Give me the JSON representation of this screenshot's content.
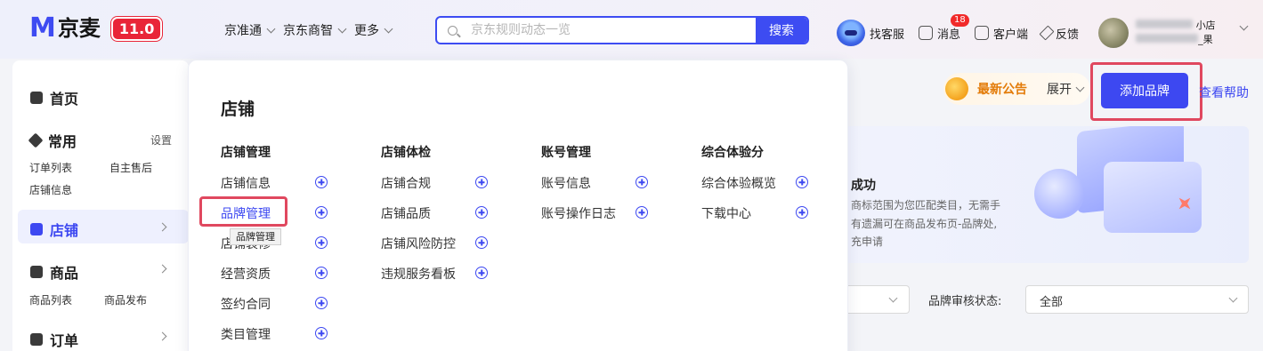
{
  "header": {
    "logo_mark": "M",
    "logo_text": "京麦",
    "version": "11.0",
    "nav": [
      "京准通",
      "京东商智",
      "更多"
    ],
    "search_placeholder": "京东规则动态一览",
    "search_button": "搜索",
    "tools": {
      "service": "找客服",
      "messages": "消息",
      "message_count": "18",
      "client": "客户端",
      "feedback": "反馈"
    },
    "user": {
      "store_suffix": "小店",
      "name_suffix": "_果"
    }
  },
  "sidebar": {
    "home": "首页",
    "common": "常用",
    "settings": "设置",
    "common_links": [
      "订单列表",
      "自主售后",
      "店铺信息"
    ],
    "store": "店铺",
    "goods": "商品",
    "goods_links": [
      "商品列表",
      "商品发布"
    ],
    "orders": "订单"
  },
  "popover": {
    "title": "店铺",
    "columns": [
      {
        "heading": "店铺管理",
        "items": [
          "店铺信息",
          "品牌管理",
          "店铺装修",
          "经营资质",
          "签约合同",
          "类目管理"
        ]
      },
      {
        "heading": "店铺体检",
        "items": [
          "店铺合规",
          "店铺品质",
          "店铺风险防控",
          "违规服务看板"
        ]
      },
      {
        "heading": "账号管理",
        "items": [
          "账号信息",
          "账号操作日志"
        ]
      },
      {
        "heading": "综合体验分",
        "items": [
          "综合体验概览",
          "下载中心"
        ]
      }
    ],
    "tooltip": "品牌管理"
  },
  "main": {
    "notice_title": "最新公告",
    "notice_expand": "展开",
    "add_brand": "添加品牌",
    "help": "查看帮助",
    "banner_title": "成功",
    "banner_lines": [
      "商标范围为您匹配类目，无需手",
      "有遗漏可在商品发布页-品牌处,",
      "充申请"
    ],
    "filter_label": "品牌审核状态:",
    "filter_value": "全部"
  },
  "colors": {
    "accent": "#3d48f1",
    "highlight": "#e0485f",
    "brand_red": "#e92538"
  }
}
